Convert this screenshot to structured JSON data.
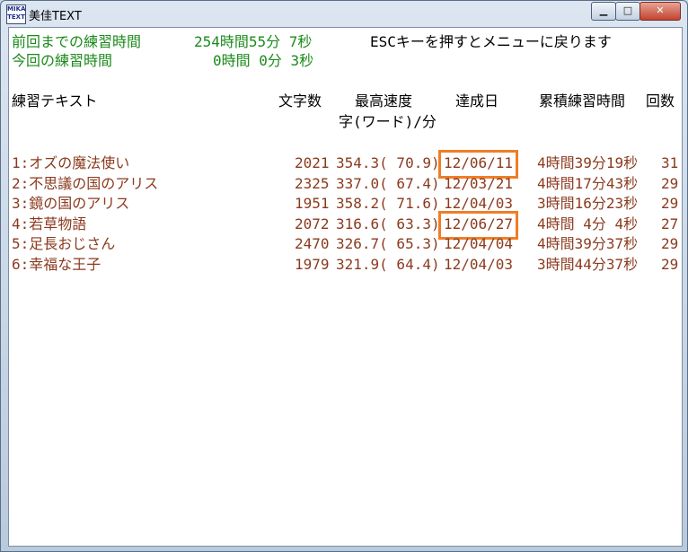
{
  "window": {
    "app_icon_text": "MIKA TEXT",
    "title": "美佳TEXT",
    "controls": {
      "minimize": "▁",
      "maximize": "□",
      "close": "✕"
    }
  },
  "header": {
    "total_label": "前回までの練習時間",
    "total_value": "254時間55分 7秒",
    "session_label": "今回の練習時間",
    "session_value": "0時間 0分 3秒",
    "esc_hint": "ESCキーを押すとメニューに戻ります"
  },
  "columns": {
    "text": "練習テキスト",
    "chars": "文字数",
    "max_speed": "最高速度",
    "speed_unit": "字(ワード)/分",
    "date": "達成日",
    "total_time": "累積練習時間",
    "count": "回数"
  },
  "rows": [
    {
      "title": "1:オズの魔法使い",
      "chars": "2021",
      "speed": "354.3( 70.9)",
      "date": "12/06/11",
      "time": "4時間39分19秒",
      "count": "31",
      "highlighted": true
    },
    {
      "title": "2:不思議の国のアリス",
      "chars": "2325",
      "speed": "337.0( 67.4)",
      "date": "12/03/21",
      "time": "4時間17分43秒",
      "count": "29",
      "highlighted": false
    },
    {
      "title": "3:鏡の国のアリス",
      "chars": "1951",
      "speed": "358.2( 71.6)",
      "date": "12/04/03",
      "time": "3時間16分23秒",
      "count": "29",
      "highlighted": false
    },
    {
      "title": "4:若草物語",
      "chars": "2072",
      "speed": "316.6( 63.3)",
      "date": "12/06/27",
      "time": "4時間 4分 4秒",
      "count": "27",
      "highlighted": true
    },
    {
      "title": "5:足長おじさん",
      "chars": "2470",
      "speed": "326.7( 65.3)",
      "date": "12/04/04",
      "time": "4時間39分37秒",
      "count": "29",
      "highlighted": false
    },
    {
      "title": "6:幸福な王子",
      "chars": "1979",
      "speed": "321.9( 64.4)",
      "date": "12/04/03",
      "time": "3時間44分37秒",
      "count": "29",
      "highlighted": false
    }
  ],
  "colors": {
    "green": "#1b8a1b",
    "brown": "#8b3a1e",
    "highlight": "#f07d26"
  }
}
